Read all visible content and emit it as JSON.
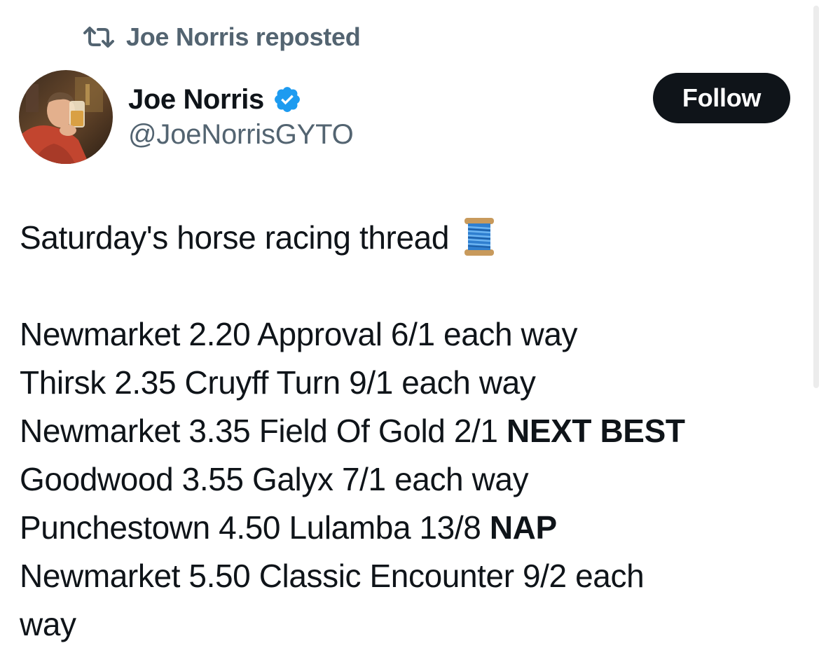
{
  "repost": {
    "text": "Joe Norris reposted",
    "icon": "repost-icon"
  },
  "author": {
    "display_name": "Joe Norris",
    "handle": "@JoeNorrisGYTO",
    "verified": true,
    "verified_color": "#1d9bf0"
  },
  "follow_button": {
    "label": "Follow"
  },
  "tweet": {
    "intro": "Saturday's horse racing thread",
    "intro_emoji": "spool-of-thread-emoji",
    "lines": [
      {
        "text": "Newmarket 2.20 Approval 6/1 each way",
        "bold": ""
      },
      {
        "text": "Thirsk 2.35 Cruyff Turn 9/1 each way",
        "bold": ""
      },
      {
        "text": "Newmarket 3.35 Field Of Gold 2/1 ",
        "bold": "NEXT BEST"
      },
      {
        "text": "Goodwood 3.55 Galyx 7/1 each way",
        "bold": ""
      },
      {
        "text": "Punchestown 4.50 Lulamba 13/8 ",
        "bold": "NAP"
      },
      {
        "text": "Newmarket 5.50 Classic Encounter 9/2 each",
        "bold": ""
      },
      {
        "text": "way",
        "bold": ""
      }
    ]
  },
  "colors": {
    "text_primary": "#0f1419",
    "text_secondary": "#536471",
    "button_bg": "#0f1419",
    "button_text": "#ffffff"
  }
}
